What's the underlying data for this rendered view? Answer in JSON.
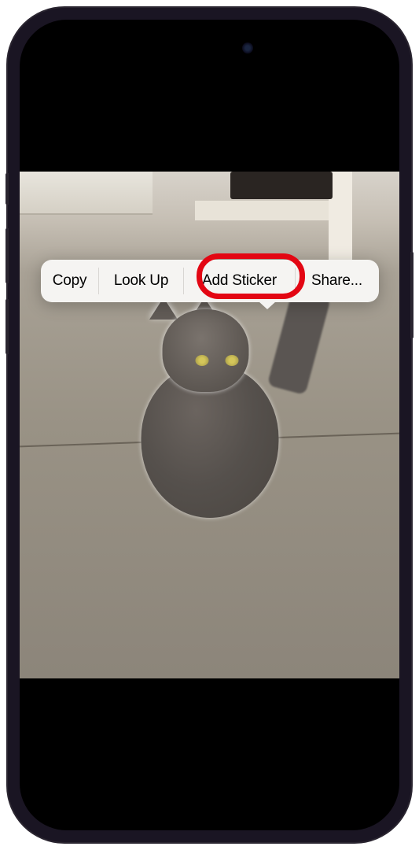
{
  "menu": {
    "copy": "Copy",
    "lookup": "Look Up",
    "addSticker": "Add Sticker",
    "share": "Share..."
  },
  "annotation": {
    "highlightColor": "#e30613",
    "highlightedItem": "addSticker"
  },
  "photo": {
    "subject": "gray-cat",
    "subjectHighlighted": true
  }
}
